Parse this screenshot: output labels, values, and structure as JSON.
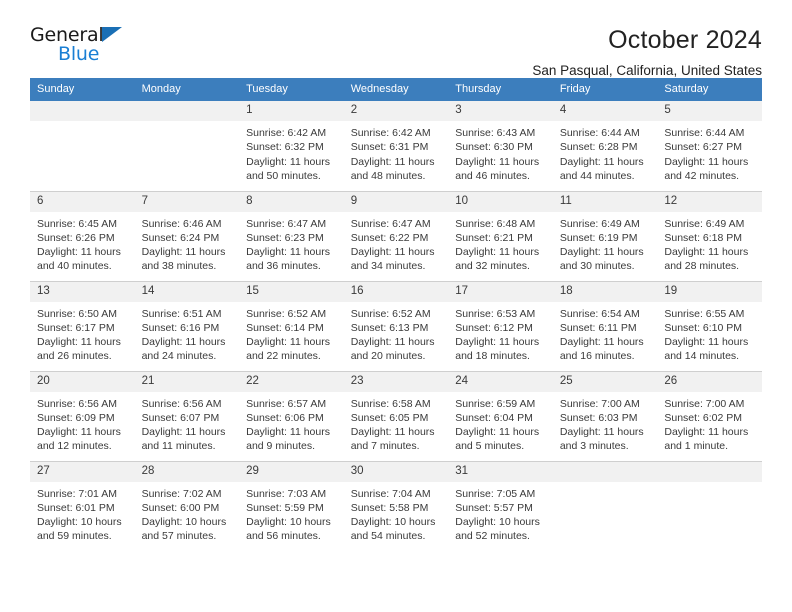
{
  "logo": {
    "word1": "General",
    "word2": "Blue",
    "triangle_color": "#1a6fb5",
    "word2_color": "#1a7fd4"
  },
  "header": {
    "title": "October 2024",
    "subtitle": "San Pasqual, California, United States"
  },
  "theme": {
    "header_blue": "#3c7ebd",
    "daynum_band": "#f1f1f1",
    "grid_line": "#cfcfcf",
    "text": "#3a3a3a"
  },
  "weekdays": [
    "Sunday",
    "Monday",
    "Tuesday",
    "Wednesday",
    "Thursday",
    "Friday",
    "Saturday"
  ],
  "weeks": [
    [
      {
        "day": "",
        "blank": true
      },
      {
        "day": "",
        "blank": true
      },
      {
        "day": "1",
        "sunrise": "Sunrise: 6:42 AM",
        "sunset": "Sunset: 6:32 PM",
        "daylight1": "Daylight: 11 hours",
        "daylight2": "and 50 minutes."
      },
      {
        "day": "2",
        "sunrise": "Sunrise: 6:42 AM",
        "sunset": "Sunset: 6:31 PM",
        "daylight1": "Daylight: 11 hours",
        "daylight2": "and 48 minutes."
      },
      {
        "day": "3",
        "sunrise": "Sunrise: 6:43 AM",
        "sunset": "Sunset: 6:30 PM",
        "daylight1": "Daylight: 11 hours",
        "daylight2": "and 46 minutes."
      },
      {
        "day": "4",
        "sunrise": "Sunrise: 6:44 AM",
        "sunset": "Sunset: 6:28 PM",
        "daylight1": "Daylight: 11 hours",
        "daylight2": "and 44 minutes."
      },
      {
        "day": "5",
        "sunrise": "Sunrise: 6:44 AM",
        "sunset": "Sunset: 6:27 PM",
        "daylight1": "Daylight: 11 hours",
        "daylight2": "and 42 minutes."
      }
    ],
    [
      {
        "day": "6",
        "sunrise": "Sunrise: 6:45 AM",
        "sunset": "Sunset: 6:26 PM",
        "daylight1": "Daylight: 11 hours",
        "daylight2": "and 40 minutes."
      },
      {
        "day": "7",
        "sunrise": "Sunrise: 6:46 AM",
        "sunset": "Sunset: 6:24 PM",
        "daylight1": "Daylight: 11 hours",
        "daylight2": "and 38 minutes."
      },
      {
        "day": "8",
        "sunrise": "Sunrise: 6:47 AM",
        "sunset": "Sunset: 6:23 PM",
        "daylight1": "Daylight: 11 hours",
        "daylight2": "and 36 minutes."
      },
      {
        "day": "9",
        "sunrise": "Sunrise: 6:47 AM",
        "sunset": "Sunset: 6:22 PM",
        "daylight1": "Daylight: 11 hours",
        "daylight2": "and 34 minutes."
      },
      {
        "day": "10",
        "sunrise": "Sunrise: 6:48 AM",
        "sunset": "Sunset: 6:21 PM",
        "daylight1": "Daylight: 11 hours",
        "daylight2": "and 32 minutes."
      },
      {
        "day": "11",
        "sunrise": "Sunrise: 6:49 AM",
        "sunset": "Sunset: 6:19 PM",
        "daylight1": "Daylight: 11 hours",
        "daylight2": "and 30 minutes."
      },
      {
        "day": "12",
        "sunrise": "Sunrise: 6:49 AM",
        "sunset": "Sunset: 6:18 PM",
        "daylight1": "Daylight: 11 hours",
        "daylight2": "and 28 minutes."
      }
    ],
    [
      {
        "day": "13",
        "sunrise": "Sunrise: 6:50 AM",
        "sunset": "Sunset: 6:17 PM",
        "daylight1": "Daylight: 11 hours",
        "daylight2": "and 26 minutes."
      },
      {
        "day": "14",
        "sunrise": "Sunrise: 6:51 AM",
        "sunset": "Sunset: 6:16 PM",
        "daylight1": "Daylight: 11 hours",
        "daylight2": "and 24 minutes."
      },
      {
        "day": "15",
        "sunrise": "Sunrise: 6:52 AM",
        "sunset": "Sunset: 6:14 PM",
        "daylight1": "Daylight: 11 hours",
        "daylight2": "and 22 minutes."
      },
      {
        "day": "16",
        "sunrise": "Sunrise: 6:52 AM",
        "sunset": "Sunset: 6:13 PM",
        "daylight1": "Daylight: 11 hours",
        "daylight2": "and 20 minutes."
      },
      {
        "day": "17",
        "sunrise": "Sunrise: 6:53 AM",
        "sunset": "Sunset: 6:12 PM",
        "daylight1": "Daylight: 11 hours",
        "daylight2": "and 18 minutes."
      },
      {
        "day": "18",
        "sunrise": "Sunrise: 6:54 AM",
        "sunset": "Sunset: 6:11 PM",
        "daylight1": "Daylight: 11 hours",
        "daylight2": "and 16 minutes."
      },
      {
        "day": "19",
        "sunrise": "Sunrise: 6:55 AM",
        "sunset": "Sunset: 6:10 PM",
        "daylight1": "Daylight: 11 hours",
        "daylight2": "and 14 minutes."
      }
    ],
    [
      {
        "day": "20",
        "sunrise": "Sunrise: 6:56 AM",
        "sunset": "Sunset: 6:09 PM",
        "daylight1": "Daylight: 11 hours",
        "daylight2": "and 12 minutes."
      },
      {
        "day": "21",
        "sunrise": "Sunrise: 6:56 AM",
        "sunset": "Sunset: 6:07 PM",
        "daylight1": "Daylight: 11 hours",
        "daylight2": "and 11 minutes."
      },
      {
        "day": "22",
        "sunrise": "Sunrise: 6:57 AM",
        "sunset": "Sunset: 6:06 PM",
        "daylight1": "Daylight: 11 hours",
        "daylight2": "and 9 minutes."
      },
      {
        "day": "23",
        "sunrise": "Sunrise: 6:58 AM",
        "sunset": "Sunset: 6:05 PM",
        "daylight1": "Daylight: 11 hours",
        "daylight2": "and 7 minutes."
      },
      {
        "day": "24",
        "sunrise": "Sunrise: 6:59 AM",
        "sunset": "Sunset: 6:04 PM",
        "daylight1": "Daylight: 11 hours",
        "daylight2": "and 5 minutes."
      },
      {
        "day": "25",
        "sunrise": "Sunrise: 7:00 AM",
        "sunset": "Sunset: 6:03 PM",
        "daylight1": "Daylight: 11 hours",
        "daylight2": "and 3 minutes."
      },
      {
        "day": "26",
        "sunrise": "Sunrise: 7:00 AM",
        "sunset": "Sunset: 6:02 PM",
        "daylight1": "Daylight: 11 hours",
        "daylight2": "and 1 minute."
      }
    ],
    [
      {
        "day": "27",
        "sunrise": "Sunrise: 7:01 AM",
        "sunset": "Sunset: 6:01 PM",
        "daylight1": "Daylight: 10 hours",
        "daylight2": "and 59 minutes."
      },
      {
        "day": "28",
        "sunrise": "Sunrise: 7:02 AM",
        "sunset": "Sunset: 6:00 PM",
        "daylight1": "Daylight: 10 hours",
        "daylight2": "and 57 minutes."
      },
      {
        "day": "29",
        "sunrise": "Sunrise: 7:03 AM",
        "sunset": "Sunset: 5:59 PM",
        "daylight1": "Daylight: 10 hours",
        "daylight2": "and 56 minutes."
      },
      {
        "day": "30",
        "sunrise": "Sunrise: 7:04 AM",
        "sunset": "Sunset: 5:58 PM",
        "daylight1": "Daylight: 10 hours",
        "daylight2": "and 54 minutes."
      },
      {
        "day": "31",
        "sunrise": "Sunrise: 7:05 AM",
        "sunset": "Sunset: 5:57 PM",
        "daylight1": "Daylight: 10 hours",
        "daylight2": "and 52 minutes."
      },
      {
        "day": "",
        "blank": true
      },
      {
        "day": "",
        "blank": true
      }
    ]
  ]
}
